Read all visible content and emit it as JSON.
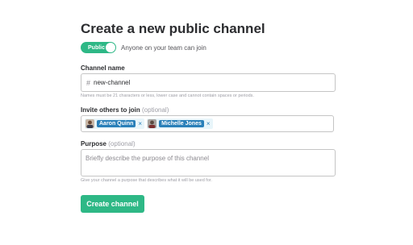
{
  "title": "Create a new public channel",
  "visibility": {
    "toggle_label": "Public",
    "description": "Anyone on your team can join"
  },
  "channel_name": {
    "label": "Channel name",
    "prefix": "#",
    "value": "new-channel",
    "hint": "Names must be 21 characters or less, lower case and cannot contain spaces or periods."
  },
  "invite": {
    "label": "Invite others to join",
    "optional": "(optional)",
    "chips": [
      {
        "name": "Aaron Quinn",
        "remove": "×"
      },
      {
        "name": "Michelle Jones",
        "remove": "×"
      }
    ]
  },
  "purpose": {
    "label": "Purpose",
    "optional": "(optional)",
    "placeholder": "Briefly describe the purpose of this channel",
    "hint": "Give your channel a purpose that describes what it will be used for."
  },
  "submit_label": "Create channel",
  "colors": {
    "accent": "#2eb886",
    "chip_blue": "#2a80b9"
  }
}
